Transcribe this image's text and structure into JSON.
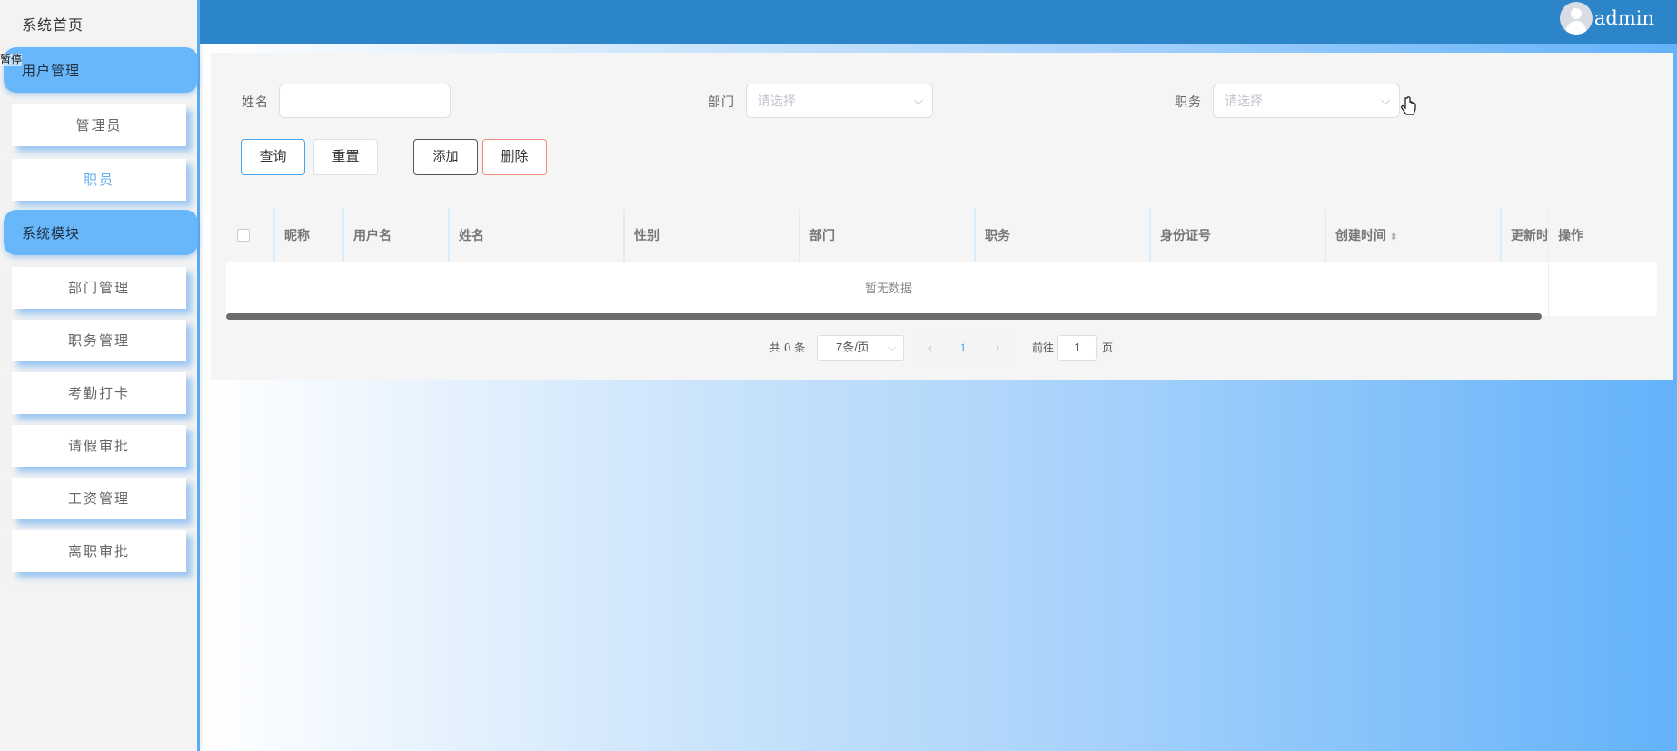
{
  "sidebar": {
    "home": "系统首页",
    "tooltip_fragment": "暂停",
    "groups": [
      {
        "label": "用户管理",
        "items": [
          "管理员",
          "职员"
        ],
        "active_item": "职员"
      },
      {
        "label": "系统模块",
        "items": [
          "部门管理",
          "职务管理",
          "考勤打卡",
          "请假审批",
          "工资管理",
          "离职审批"
        ]
      }
    ]
  },
  "header": {
    "username": "admin",
    "avatar_icon": "user-avatar-icon"
  },
  "search": {
    "name_label": "姓名",
    "name_value": "",
    "dept_label": "部门",
    "dept_placeholder": "请选择",
    "position_label": "职务",
    "position_placeholder": "请选择"
  },
  "buttons": {
    "query": "查询",
    "reset": "重置",
    "add": "添加",
    "delete": "删除"
  },
  "table": {
    "columns": [
      "昵称",
      "用户名",
      "姓名",
      "性别",
      "部门",
      "职务",
      "身份证号",
      "创建时间",
      "更新时间",
      "操作"
    ],
    "empty_text": "暂无数据",
    "rows": []
  },
  "pagination": {
    "total_text": "共 0 条",
    "page_size": "7条/页",
    "current_page": "1",
    "goto_prefix": "前往",
    "goto_value": "1",
    "goto_suffix": "页"
  },
  "colors": {
    "header": "#2c84c9",
    "accent": "#69b7fb",
    "primary_link": "#409eff",
    "delete_border": "#f08a7a"
  }
}
